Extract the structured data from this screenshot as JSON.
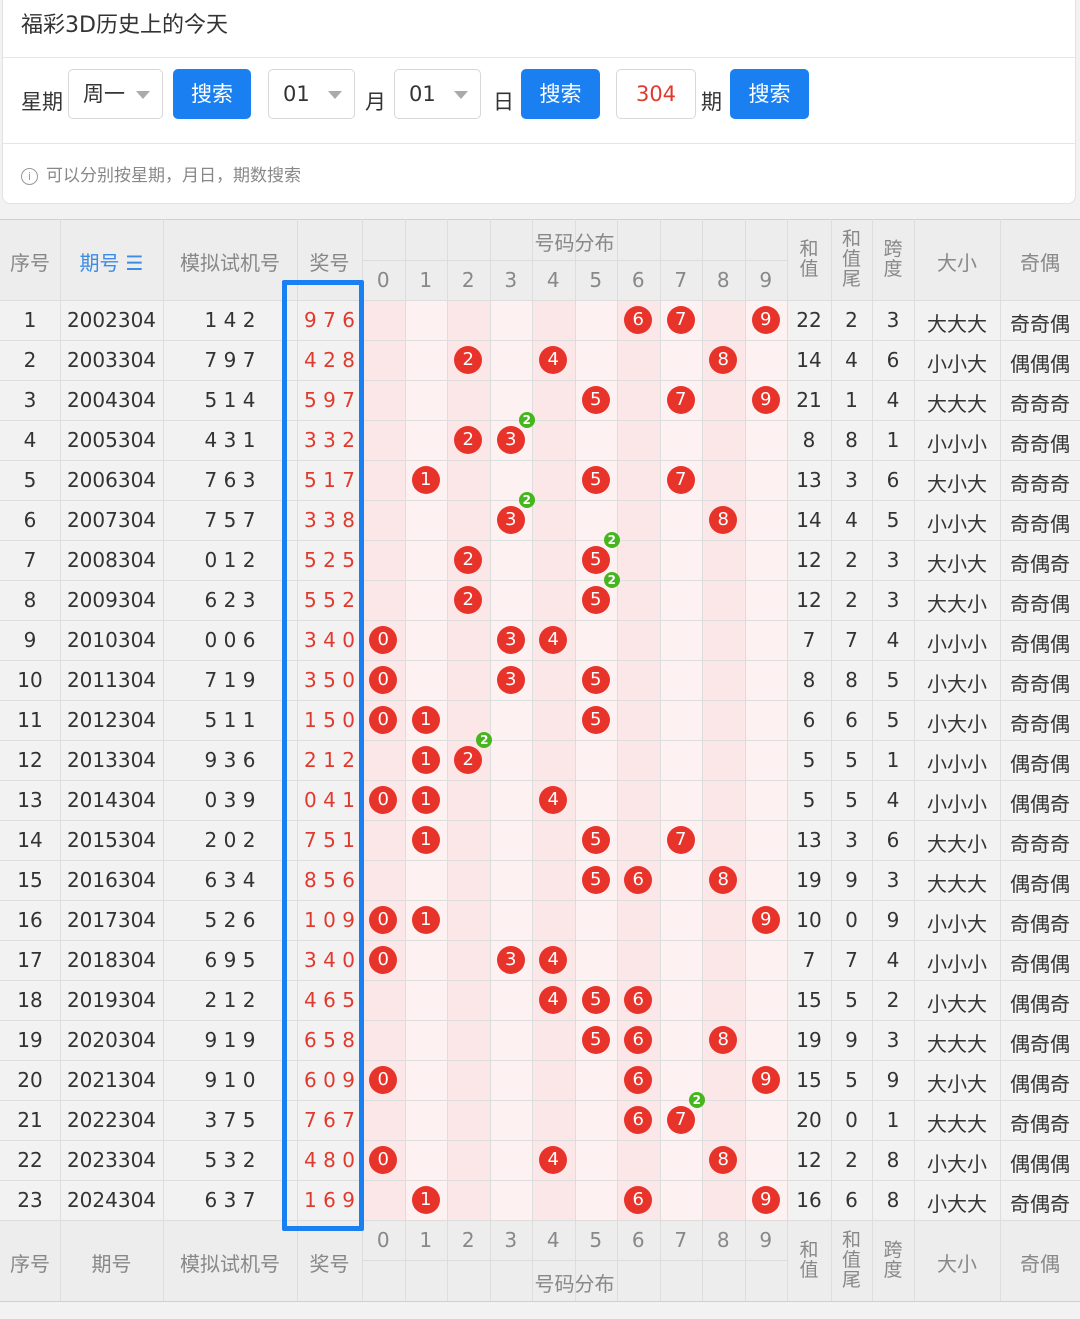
{
  "header": {
    "title": "福彩3D历史上的今天"
  },
  "search": {
    "weekday_label": "星期",
    "weekday_value": "周一",
    "search_label": "搜索",
    "month_value": "01",
    "month_label": "月",
    "day_value": "01",
    "day_label": "日",
    "period_value": "304",
    "period_label": "期",
    "hint": "可以分别按星期，月日，期数搜索"
  },
  "table": {
    "headers": {
      "index": "序号",
      "period": "期号",
      "period_sort_icon": "☰",
      "sim": "模拟试机号",
      "prize": "奖号",
      "dist": "号码分布",
      "sum": "和值",
      "sum_tail": "和值尾",
      "span": "跨度",
      "size": "大小",
      "parity": "奇偶"
    },
    "footer_period": "期号",
    "digits": [
      "0",
      "1",
      "2",
      "3",
      "4",
      "5",
      "6",
      "7",
      "8",
      "9"
    ],
    "rows": [
      {
        "idx": "1",
        "period": "2002304",
        "sim": "1 4 2",
        "prize": "9 7 6",
        "sum": "22",
        "tail": "2",
        "span": "3",
        "size": "大大大",
        "parity": "奇奇偶",
        "balls": [
          6,
          7,
          9
        ],
        "dup": null
      },
      {
        "idx": "2",
        "period": "2003304",
        "sim": "7 9 7",
        "prize": "4 2 8",
        "sum": "14",
        "tail": "4",
        "span": "6",
        "size": "小小大",
        "parity": "偶偶偶",
        "balls": [
          2,
          4,
          8
        ],
        "dup": null
      },
      {
        "idx": "3",
        "period": "2004304",
        "sim": "5 1 4",
        "prize": "5 9 7",
        "sum": "21",
        "tail": "1",
        "span": "4",
        "size": "大大大",
        "parity": "奇奇奇",
        "balls": [
          5,
          7,
          9
        ],
        "dup": null
      },
      {
        "idx": "4",
        "period": "2005304",
        "sim": "4 3 1",
        "prize": "3 3 2",
        "sum": "8",
        "tail": "8",
        "span": "1",
        "size": "小小小",
        "parity": "奇奇偶",
        "balls": [
          2,
          3
        ],
        "dup": 3
      },
      {
        "idx": "5",
        "period": "2006304",
        "sim": "7 6 3",
        "prize": "5 1 7",
        "sum": "13",
        "tail": "3",
        "span": "6",
        "size": "大小大",
        "parity": "奇奇奇",
        "balls": [
          1,
          5,
          7
        ],
        "dup": null
      },
      {
        "idx": "6",
        "period": "2007304",
        "sim": "7 5 7",
        "prize": "3 3 8",
        "sum": "14",
        "tail": "4",
        "span": "5",
        "size": "小小大",
        "parity": "奇奇偶",
        "balls": [
          3,
          8
        ],
        "dup": 3
      },
      {
        "idx": "7",
        "period": "2008304",
        "sim": "0 1 2",
        "prize": "5 2 5",
        "sum": "12",
        "tail": "2",
        "span": "3",
        "size": "大小大",
        "parity": "奇偶奇",
        "balls": [
          2,
          5
        ],
        "dup": 5
      },
      {
        "idx": "8",
        "period": "2009304",
        "sim": "6 2 3",
        "prize": "5 5 2",
        "sum": "12",
        "tail": "2",
        "span": "3",
        "size": "大大小",
        "parity": "奇奇偶",
        "balls": [
          2,
          5
        ],
        "dup": 5
      },
      {
        "idx": "9",
        "period": "2010304",
        "sim": "0 0 6",
        "prize": "3 4 0",
        "sum": "7",
        "tail": "7",
        "span": "4",
        "size": "小小小",
        "parity": "奇偶偶",
        "balls": [
          0,
          3,
          4
        ],
        "dup": null
      },
      {
        "idx": "10",
        "period": "2011304",
        "sim": "7 1 9",
        "prize": "3 5 0",
        "sum": "8",
        "tail": "8",
        "span": "5",
        "size": "小大小",
        "parity": "奇奇偶",
        "balls": [
          0,
          3,
          5
        ],
        "dup": null
      },
      {
        "idx": "11",
        "period": "2012304",
        "sim": "5 1 1",
        "prize": "1 5 0",
        "sum": "6",
        "tail": "6",
        "span": "5",
        "size": "小大小",
        "parity": "奇奇偶",
        "balls": [
          0,
          1,
          5
        ],
        "dup": null
      },
      {
        "idx": "12",
        "period": "2013304",
        "sim": "9 3 6",
        "prize": "2 1 2",
        "sum": "5",
        "tail": "5",
        "span": "1",
        "size": "小小小",
        "parity": "偶奇偶",
        "balls": [
          1,
          2
        ],
        "dup": 2
      },
      {
        "idx": "13",
        "period": "2014304",
        "sim": "0 3 9",
        "prize": "0 4 1",
        "sum": "5",
        "tail": "5",
        "span": "4",
        "size": "小小小",
        "parity": "偶偶奇",
        "balls": [
          0,
          1,
          4
        ],
        "dup": null
      },
      {
        "idx": "14",
        "period": "2015304",
        "sim": "2 0 2",
        "prize": "7 5 1",
        "sum": "13",
        "tail": "3",
        "span": "6",
        "size": "大大小",
        "parity": "奇奇奇",
        "balls": [
          1,
          5,
          7
        ],
        "dup": null
      },
      {
        "idx": "15",
        "period": "2016304",
        "sim": "6 3 4",
        "prize": "8 5 6",
        "sum": "19",
        "tail": "9",
        "span": "3",
        "size": "大大大",
        "parity": "偶奇偶",
        "balls": [
          5,
          6,
          8
        ],
        "dup": null
      },
      {
        "idx": "16",
        "period": "2017304",
        "sim": "5 2 6",
        "prize": "1 0 9",
        "sum": "10",
        "tail": "0",
        "span": "9",
        "size": "小小大",
        "parity": "奇偶奇",
        "balls": [
          0,
          1,
          9
        ],
        "dup": null
      },
      {
        "idx": "17",
        "period": "2018304",
        "sim": "6 9 5",
        "prize": "3 4 0",
        "sum": "7",
        "tail": "7",
        "span": "4",
        "size": "小小小",
        "parity": "奇偶偶",
        "balls": [
          0,
          3,
          4
        ],
        "dup": null
      },
      {
        "idx": "18",
        "period": "2019304",
        "sim": "2 1 2",
        "prize": "4 6 5",
        "sum": "15",
        "tail": "5",
        "span": "2",
        "size": "小大大",
        "parity": "偶偶奇",
        "balls": [
          4,
          5,
          6
        ],
        "dup": null
      },
      {
        "idx": "19",
        "period": "2020304",
        "sim": "9 1 9",
        "prize": "6 5 8",
        "sum": "19",
        "tail": "9",
        "span": "3",
        "size": "大大大",
        "parity": "偶奇偶",
        "balls": [
          5,
          6,
          8
        ],
        "dup": null
      },
      {
        "idx": "20",
        "period": "2021304",
        "sim": "9 1 0",
        "prize": "6 0 9",
        "sum": "15",
        "tail": "5",
        "span": "9",
        "size": "大小大",
        "parity": "偶偶奇",
        "balls": [
          0,
          6,
          9
        ],
        "dup": null
      },
      {
        "idx": "21",
        "period": "2022304",
        "sim": "3 7 5",
        "prize": "7 6 7",
        "sum": "20",
        "tail": "0",
        "span": "1",
        "size": "大大大",
        "parity": "奇偶奇",
        "balls": [
          6,
          7
        ],
        "dup": 7
      },
      {
        "idx": "22",
        "period": "2023304",
        "sim": "5 3 2",
        "prize": "4 8 0",
        "sum": "12",
        "tail": "2",
        "span": "8",
        "size": "小大小",
        "parity": "偶偶偶",
        "balls": [
          0,
          4,
          8
        ],
        "dup": null
      },
      {
        "idx": "23",
        "period": "2024304",
        "sim": "6 3 7",
        "prize": "1 6 9",
        "sum": "16",
        "tail": "6",
        "span": "8",
        "size": "小大大",
        "parity": "奇偶奇",
        "balls": [
          1,
          6,
          9
        ],
        "dup": null
      }
    ]
  },
  "colors": {
    "ball": "#e8332a",
    "dup_badge": "#46b61e",
    "highlight": "#1a7ff0",
    "accent": "#1a7ff0"
  }
}
